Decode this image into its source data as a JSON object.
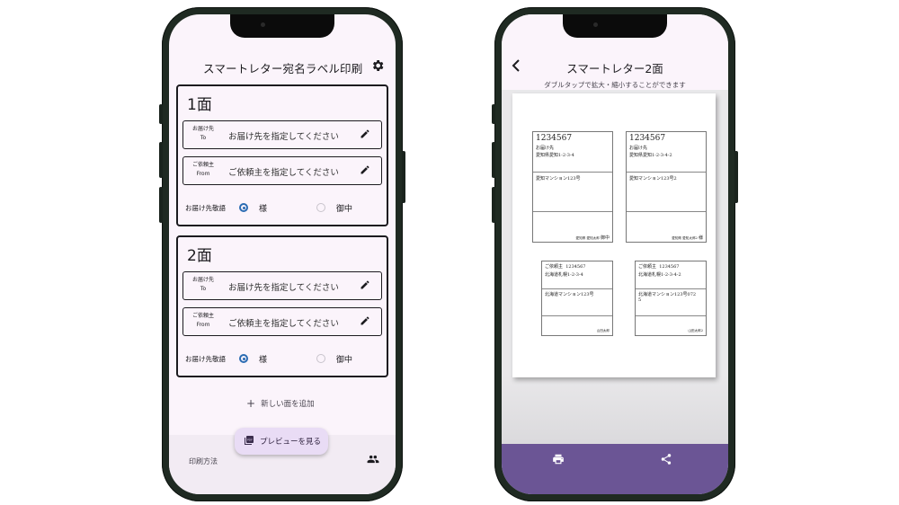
{
  "left": {
    "title": "スマートレター宛名ラベル印刷",
    "faces": [
      {
        "title": "1面",
        "to_label": [
          "お届け先",
          "To"
        ],
        "to_placeholder": "お届け先を指定してください",
        "from_label": [
          "ご依頼主",
          "From"
        ],
        "from_placeholder": "ご依頼主を指定してください",
        "honorific_label": "お届け先敬語",
        "option_sama": "様",
        "option_onchu": "御中",
        "selected": "様"
      },
      {
        "title": "2面",
        "to_label": [
          "お届け先",
          "To"
        ],
        "to_placeholder": "お届け先を指定してください",
        "from_label": [
          "ご依頼主",
          "From"
        ],
        "from_placeholder": "ご依頼主を指定してください",
        "honorific_label": "お届け先敬語",
        "option_sama": "様",
        "option_onchu": "御中",
        "selected": "様"
      }
    ],
    "add_face": "新しい面を追加",
    "preview_button": "プレビューを見る",
    "nav_howto": "印刷方法",
    "icons": [
      "gear-icon",
      "edit-icon",
      "plus-icon",
      "pdf-icon",
      "people-icon"
    ],
    "accent_color": "#2b6cb3"
  },
  "right": {
    "title": "スマートレター2面",
    "hint": "ダブルタップで拡大・縮小することができます",
    "labels": [
      {
        "zip": "1234567",
        "heading": "お届け先",
        "addr": "愛知県愛知1-2-3-4",
        "building": "愛知マンション123号",
        "sender": "愛知県 愛知太郎",
        "honor": "御中"
      },
      {
        "zip": "1234567",
        "heading": "お届け先",
        "addr": "愛知県愛知1-2-3-4-2",
        "building": "愛知マンション123号2",
        "sender": "愛知県 愛知太郎2",
        "honor": "様"
      },
      {
        "zip": "1234567",
        "heading": "ご依頼主",
        "addr": "北海道札幌1-2-3-4",
        "building": "北海道マンション123号",
        "sender": "山田太郎"
      },
      {
        "zip": "1234567",
        "heading": "ご依頼主",
        "addr": "北海道札幌1-2-3-4-2",
        "building": "北海道マンション123号072",
        "building2": "5",
        "sender": "山田太郎2"
      }
    ],
    "icons": [
      "back-icon",
      "print-icon",
      "share-icon"
    ],
    "bottom_color": "#6b5595"
  }
}
